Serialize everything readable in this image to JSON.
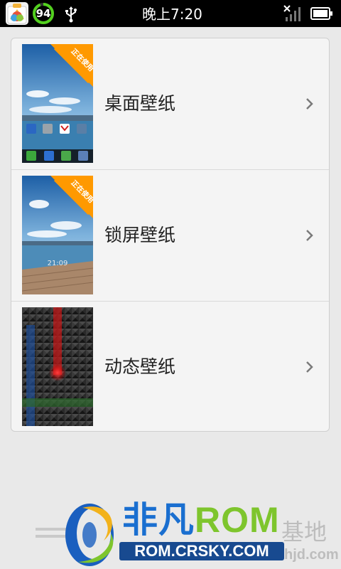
{
  "status_bar": {
    "battery_percent": "94",
    "time": "晚上7:20",
    "icons": [
      "app-notification-icon",
      "battery-ring-icon",
      "usb-icon",
      "signal-icon",
      "battery-icon"
    ]
  },
  "wallpaper_list": {
    "items": [
      {
        "label": "桌面壁纸",
        "badge": "正在使用",
        "thumb_icons": [
          "talk",
          "search",
          "gmail",
          "settings"
        ],
        "dock_icons": [
          "phone",
          "contacts",
          "messages",
          "browser"
        ]
      },
      {
        "label": "锁屏壁纸",
        "badge": "正在使用",
        "lock_time": "21:09"
      },
      {
        "label": "动态壁纸"
      }
    ],
    "chevron_icon": "chevron-right-icon"
  },
  "watermark": {
    "brand_cn": "非凡",
    "brand_en": "ROM",
    "url": "ROM.CRSKY.COM",
    "right_cn": "基地",
    "right_domain": "hjd.com"
  },
  "colors": {
    "status_bar_bg": "#000000",
    "page_bg": "#e9e9e9",
    "card_bg": "#f4f4f4",
    "badge": "#ff9900",
    "brand_blue": "#1a6fd0",
    "brand_green": "#7ec52d"
  }
}
